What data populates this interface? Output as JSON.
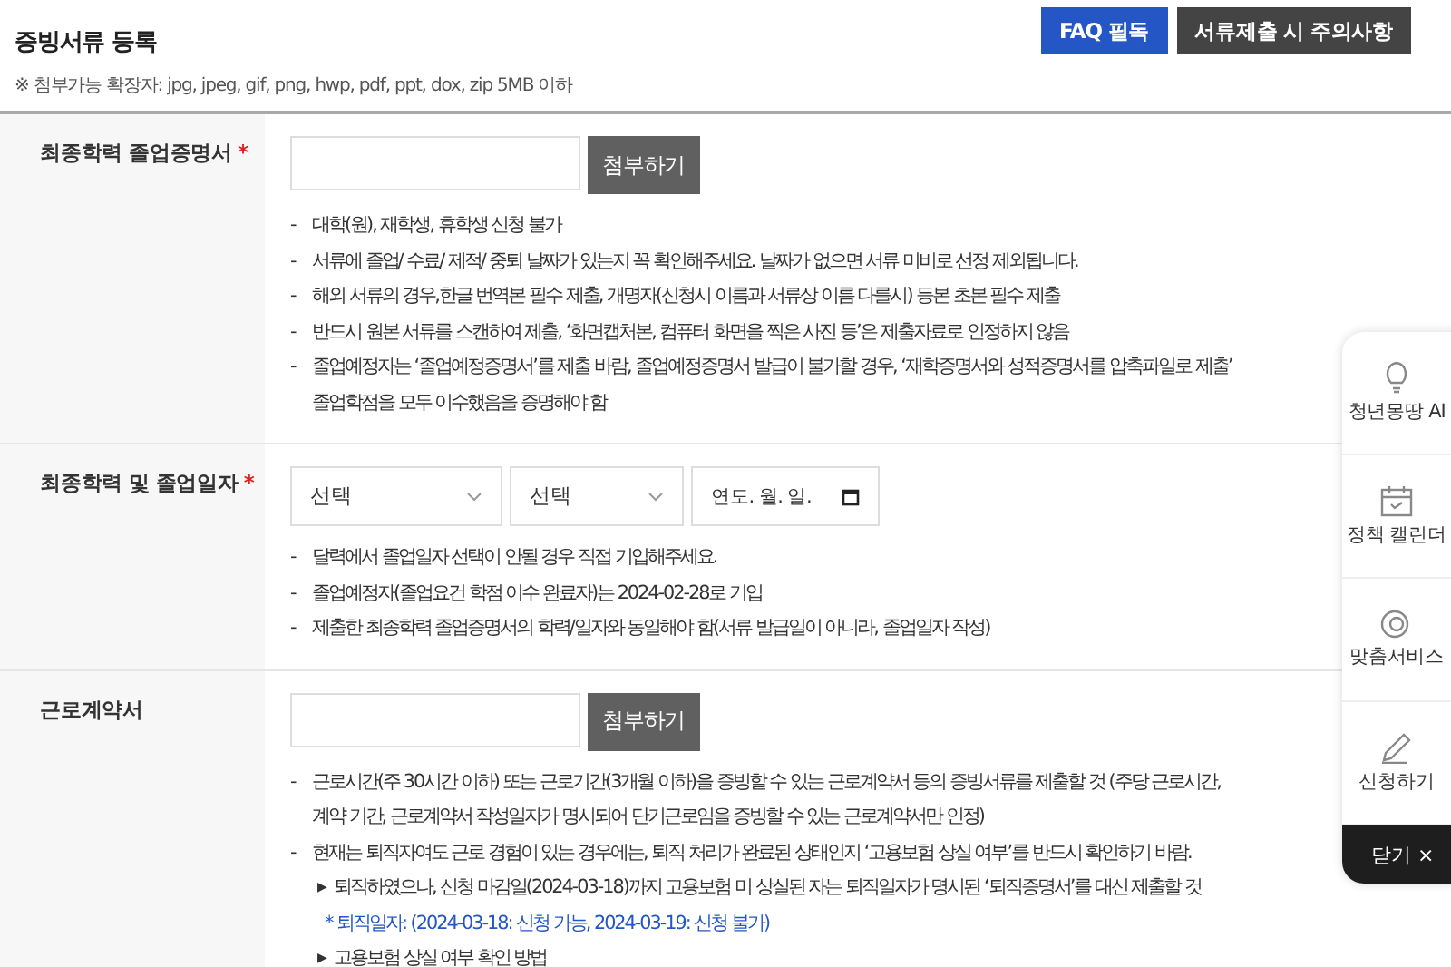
{
  "header": {
    "title": "증빙서류 등록",
    "note": "※ 첨부가능 확장자: jpg, jpeg, gif, png, hwp, pdf, ppt, dox, zip 5MB 이하",
    "buttons": [
      {
        "label": "FAQ 필독",
        "kind": "primary"
      },
      {
        "label": "서류제출 시 주의사항",
        "kind": "dark"
      }
    ]
  },
  "rows": [
    {
      "label": "최종학력 졸업증명서",
      "required_mark": "*",
      "kind": "file",
      "attach_label": "첨부하기",
      "notes": [
        {
          "bullet": "-",
          "lines": [
            "대학(원), 재학생, 휴학생 신청 불가"
          ]
        },
        {
          "bullet": "-",
          "lines": [
            "서류에 졸업/ 수료/ 제적/ 중퇴 날짜가 있는지 꼭 확인해주세요. 날짜가 없으면 서류 미비로 선정 제외됩니다."
          ]
        },
        {
          "bullet": "-",
          "lines": [
            "해외 서류의 경우,한글 번역본 필수 제출, 개명자(신청시 이름과 서류상 이름 다를시) 등본 초본 필수 제출"
          ]
        },
        {
          "bullet": "-",
          "lines": [
            "반드시 원본 서류를 스캔하여 제출, ‘화면캡처본, 컴퓨터 화면을 찍은 사진 등’은 제출자료로 인정하지 않음"
          ]
        },
        {
          "bullet": "-",
          "lines": [
            "졸업예정자는 ‘졸업예정증명서’를 제출 바람, 졸업예정증명서 발급이 불가할 경우, ‘재학증명서와 성적증명서를 압축파일로 제출’",
            "졸업학점을 모두 이수했음을 증명해야 함"
          ]
        }
      ]
    },
    {
      "label": "최종학력 및 졸업일자",
      "required_mark": "*",
      "kind": "date",
      "selects": [
        {
          "value": "선택"
        },
        {
          "value": "선택"
        }
      ],
      "date_placeholder": "연도. 월. 일.",
      "notes": [
        {
          "bullet": "-",
          "lines": [
            "달력에서 졸업일자 선택이 안될 경우 직접 기입해주세요."
          ]
        },
        {
          "bullet": "-",
          "lines": [
            "졸업예정자(졸업요건 학점 이수 완료자)는 2024-02-28로 기입"
          ]
        },
        {
          "bullet": "-",
          "lines": [
            "제출한 최종학력 졸업증명서의 학력/일자와 동일해야 함(서류 발급일이 아니라, 졸업일자 작성)"
          ]
        }
      ]
    },
    {
      "label": "근로계약서",
      "kind": "file",
      "attach_label": "첨부하기",
      "notes": [
        {
          "bullet": "-",
          "lines": [
            "근로시간(주 30시간 이하) 또는 근로기간(3개월 이하)을 증빙할 수 있는 근로계약서 등의 증빙서류를 제출할 것 (주당 근로시간,",
            "계약 기간, 근로계약서 작성일자가 명시되어 단기근로임을 증빙할 수 있는 근로계약서만 인정)"
          ]
        },
        {
          "bullet": "-",
          "lines": [
            "현재는 퇴직자여도 근로 경험이 있는 경우에는, 퇴직 처리가 완료된 상태인지 ‘고용보험 상실 여부’를 반드시 확인하기 바람."
          ],
          "subs": [
            {
              "kind": "bullet",
              "bullet": "▶",
              "text": "퇴직하였으나, 신청 마감일(2024-03-18)까지 고용보험 미 상실된 자는 퇴직일자가 명시된 ‘퇴직증명서’를 대신 제출할 것"
            },
            {
              "kind": "highlight",
              "text": "* 퇴직일자: (2024-03-18: 신청 가능, 2024-03-19: 신청 불가)"
            },
            {
              "kind": "bullet",
              "bullet": "▶",
              "text": "고용보험 상실 여부 확인 방법"
            }
          ]
        }
      ]
    }
  ],
  "quick_menu": {
    "items": [
      {
        "label": "청년몽땅 AI"
      },
      {
        "label": "정책 캘린더"
      },
      {
        "label": "맞춤서비스"
      },
      {
        "label": "신청하기"
      }
    ],
    "close_label": "닫기 ×"
  }
}
